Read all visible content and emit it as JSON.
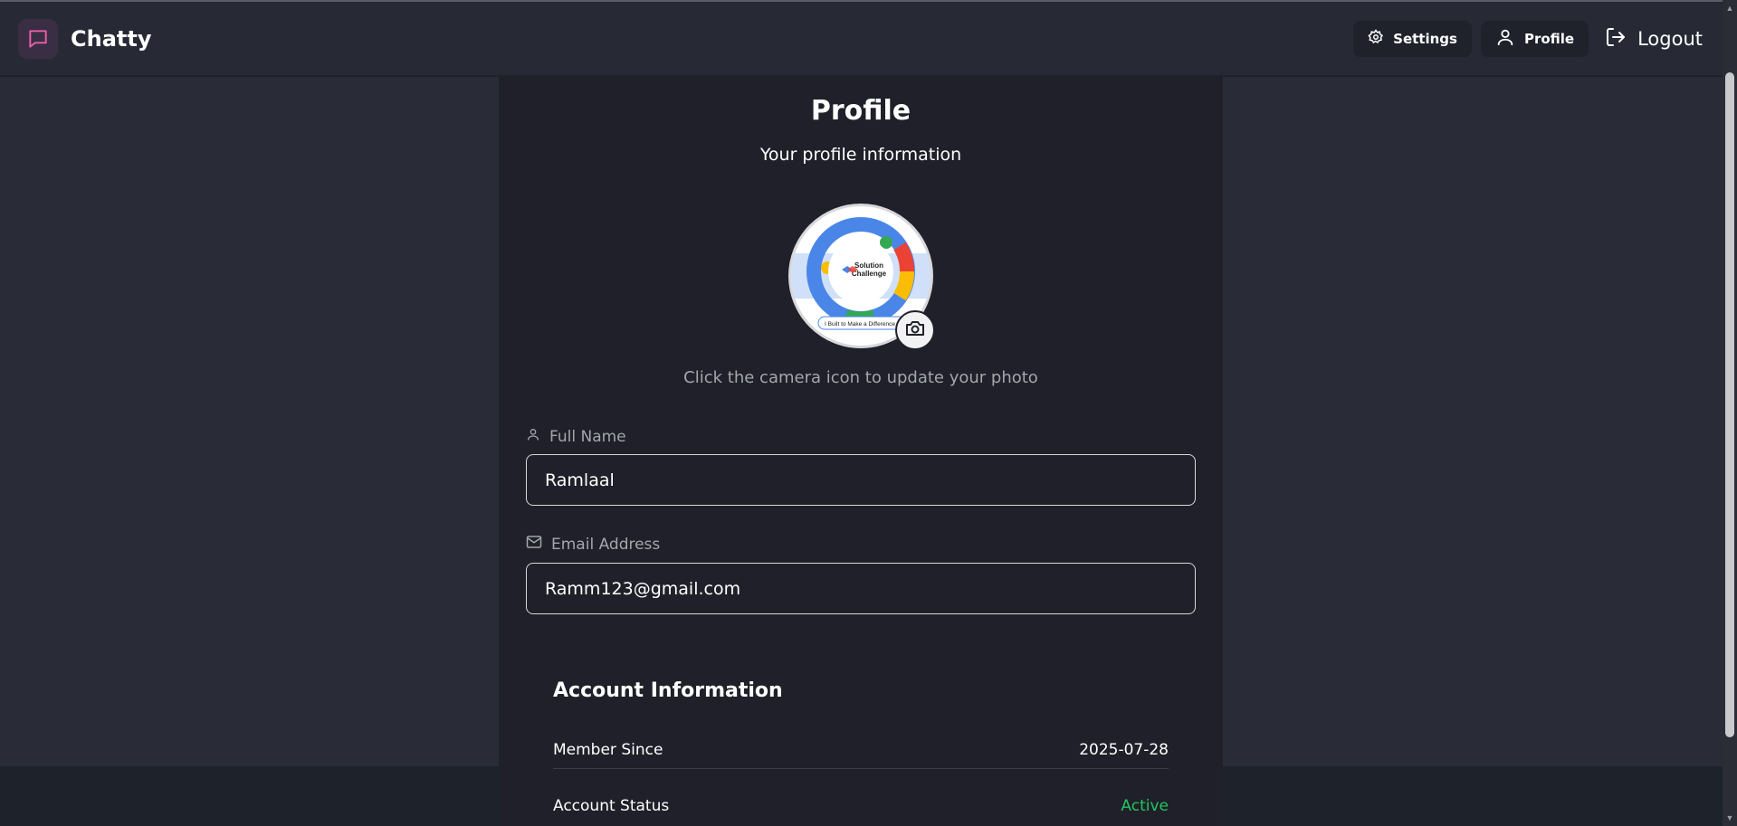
{
  "app": {
    "name": "Chatty",
    "accent_color": "#e85fa9"
  },
  "nav": {
    "settings_label": "Settings",
    "profile_label": "Profile",
    "logout_label": "Logout"
  },
  "profile": {
    "title": "Profile",
    "subtitle": "Your profile information",
    "photo_hint": "Click the camera icon to update your photo",
    "avatar_image_text": {
      "line1": "Solution",
      "line2": "Challenge",
      "banner": "I Built to Make a Difference"
    },
    "full_name_label": "Full Name",
    "full_name_value": "Ramlaal",
    "email_label": "Email Address",
    "email_value": "Ramm123@gmail.com"
  },
  "account": {
    "title": "Account Information",
    "rows": [
      {
        "label": "Member Since",
        "value": "2025-07-28"
      },
      {
        "label": "Account Status",
        "value": "Active",
        "status_color": "#22c55e"
      }
    ]
  }
}
